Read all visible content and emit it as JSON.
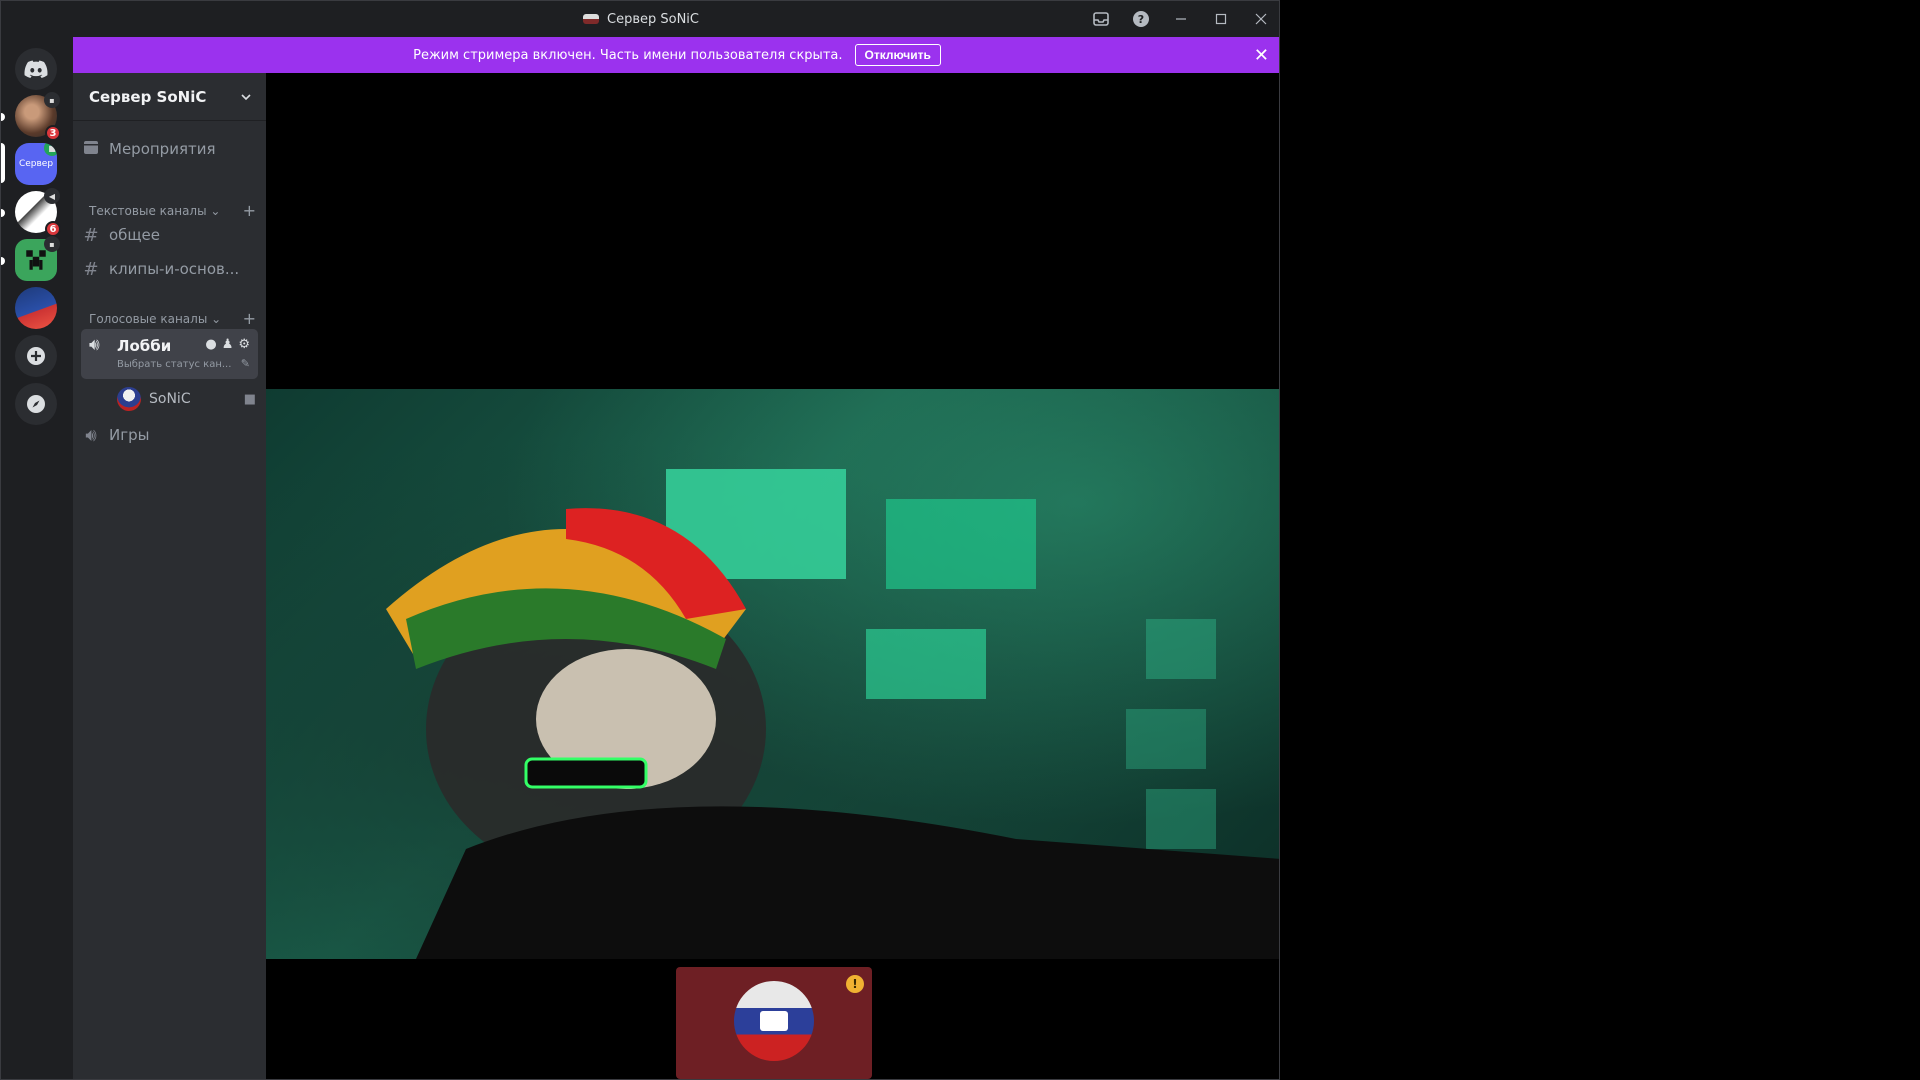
{
  "window": {
    "title": "Сервер SoNiC"
  },
  "banner": {
    "message": "Режим стримера включен. Часть имени пользователя скрыта.",
    "button_label": "Отключить"
  },
  "rail": {
    "servers": [
      {
        "name": "server-1",
        "badge": "3"
      },
      {
        "name": "server-sonic",
        "label": "Сервер",
        "selected": true
      },
      {
        "name": "server-3",
        "badge": "6"
      },
      {
        "name": "server-4"
      },
      {
        "name": "server-5"
      }
    ]
  },
  "sidebar": {
    "server_name": "Сервер SoNiC",
    "events_label": "Мероприятия",
    "text_category": "Текстовые каналы",
    "text_channels": [
      "общее",
      "клипы-и-основ..."
    ],
    "voice_category": "Голосовые каналы",
    "lobby": {
      "name": "Лобби",
      "status": "Выбрать статус кан..."
    },
    "voice_user": "SoNiC",
    "games_channel": "Игры"
  },
  "colors": {
    "banner": "#9b32ee",
    "sidebar": "#2b2d31",
    "rail": "#1e1f22",
    "tile": "#6e1f24"
  }
}
